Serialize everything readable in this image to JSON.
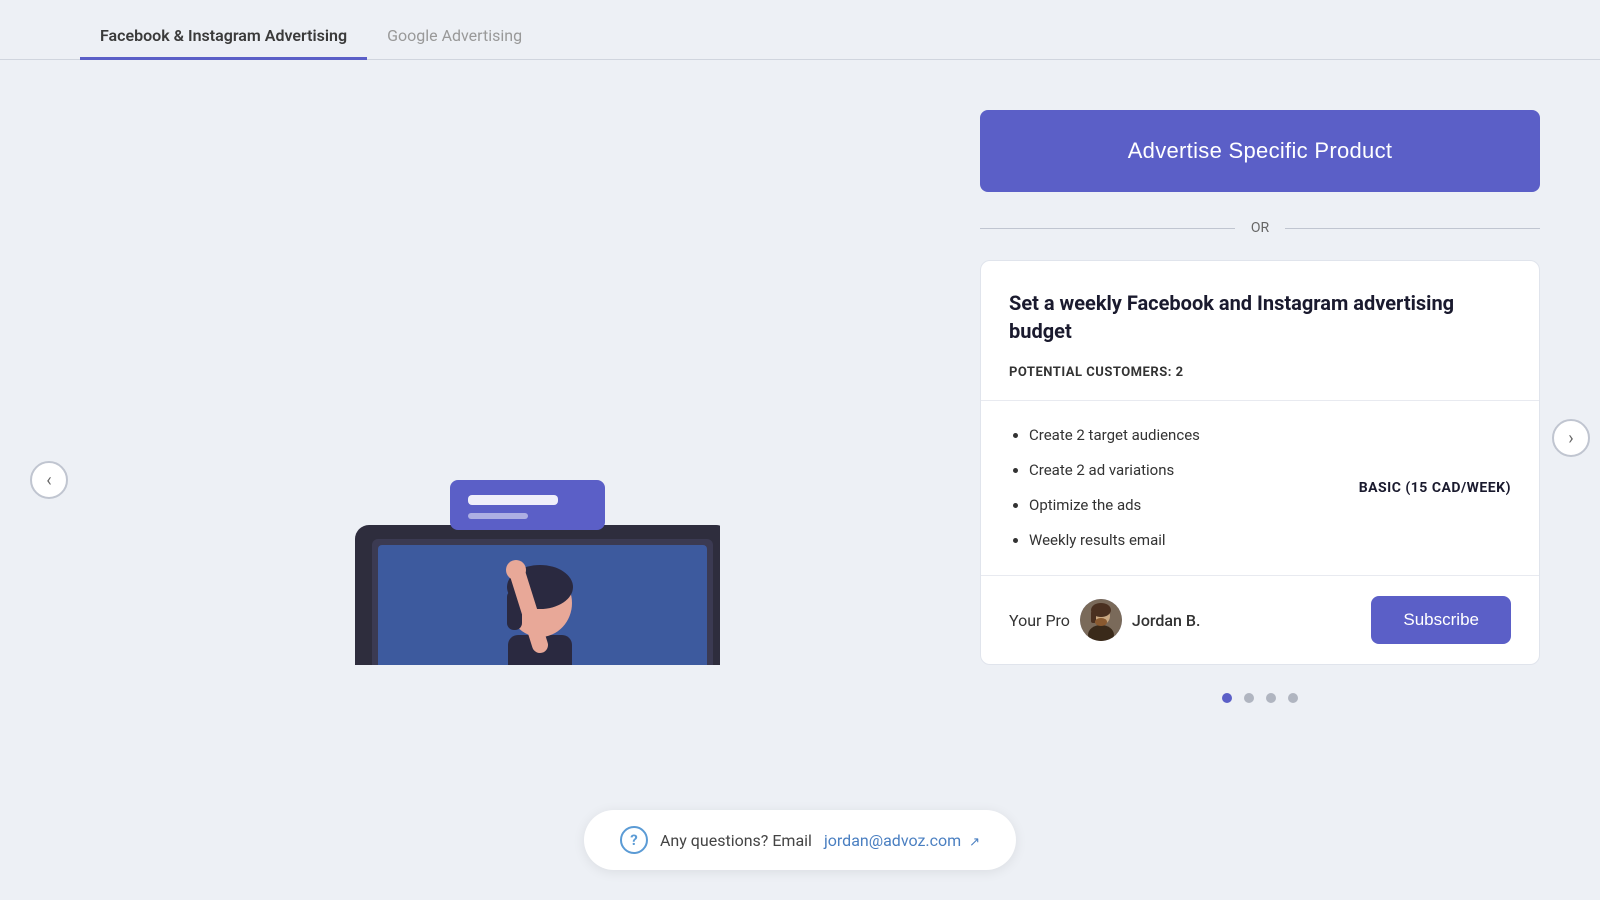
{
  "tabs": [
    {
      "id": "fb",
      "label": "Facebook & Instagram Advertising",
      "active": true
    },
    {
      "id": "google",
      "label": "Google Advertising",
      "active": false
    }
  ],
  "advertise_button": {
    "label": "Advertise Specific Product"
  },
  "or_text": "OR",
  "card": {
    "title": "Set a weekly Facebook and Instagram advertising budget",
    "potential_customers_label": "POTENTIAL CUSTOMERS:",
    "potential_customers_value": "2",
    "features": [
      "Create 2 target audiences",
      "Create 2 ad variations",
      "Optimize the ads",
      "Weekly results email"
    ],
    "plan_label": "BASIC (15 CAD/WEEK)",
    "pro_label": "Your Pro",
    "pro_name": "Jordan B.",
    "subscribe_label": "Subscribe"
  },
  "carousel": {
    "dots": [
      {
        "active": true
      },
      {
        "active": false
      },
      {
        "active": false
      },
      {
        "active": false
      }
    ]
  },
  "nav_arrows": {
    "prev": "‹",
    "next": "›"
  },
  "help": {
    "question_text": "Any questions? Email",
    "email": "jordan@advoz.com",
    "email_href": "mailto:jordan@advoz.com"
  },
  "colors": {
    "accent": "#5b5fc7",
    "tab_active": "#5b5fc7"
  }
}
